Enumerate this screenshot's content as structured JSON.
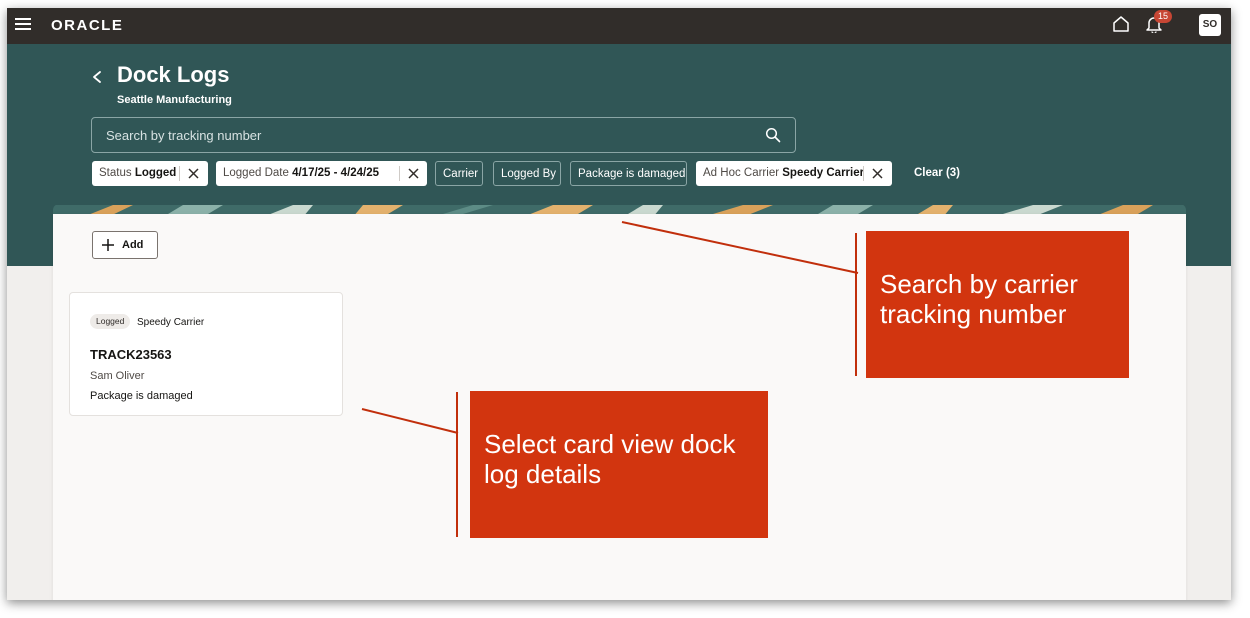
{
  "app": {
    "brand": "ORACLE",
    "notification_count": "15",
    "user_initials": "SO"
  },
  "page": {
    "title": "Dock Logs",
    "subtitle": "Seattle Manufacturing"
  },
  "search": {
    "placeholder": "Search by tracking number"
  },
  "filters": [
    {
      "label": "Status",
      "value": "Logged",
      "removable": true
    },
    {
      "label": "Logged Date",
      "value": "4/17/25 - 4/24/25",
      "removable": true
    },
    {
      "label": "Carrier",
      "value": "",
      "removable": false
    },
    {
      "label": "Logged By",
      "value": "",
      "removable": false
    },
    {
      "label": "Package is damaged",
      "value": "",
      "removable": false
    },
    {
      "label": "Ad Hoc Carrier",
      "value": "Speedy Carrier",
      "removable": true
    }
  ],
  "clear_label": "Clear (3)",
  "actions": {
    "add_label": "Add"
  },
  "cards": [
    {
      "status": "Logged",
      "carrier": "Speedy Carrier",
      "tracking": "TRACK23563",
      "logged_by": "Sam Oliver",
      "note": "Package is damaged"
    }
  ],
  "callouts": {
    "search": "Search by carrier tracking number",
    "card": "Select card view dock log details"
  },
  "colors": {
    "header_bg": "#305656",
    "topbar_bg": "#312d2a",
    "callout_bg": "#d2350f",
    "badge": "#c74634"
  }
}
